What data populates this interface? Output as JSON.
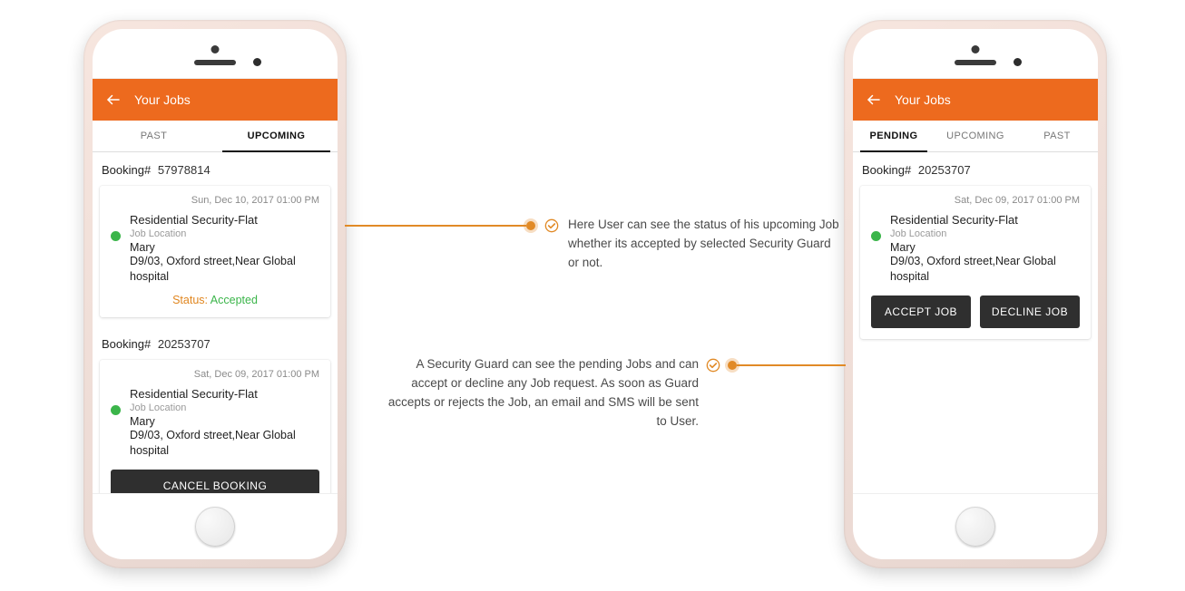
{
  "left": {
    "header": {
      "title": "Your Jobs"
    },
    "tabs": {
      "past": "PAST",
      "upcoming": "UPCOMING"
    },
    "bookingLabel": "Booking#",
    "booking1": {
      "number": "57978814",
      "date": "Sun, Dec 10, 2017 01:00 PM",
      "jobTitle": "Residential Security-Flat",
      "locationLabel": "Job Location",
      "name": "Mary",
      "address": "D9/03, Oxford street,Near Global hospital",
      "statusPrefix": "Status:",
      "statusValue": "Accepted"
    },
    "booking2": {
      "number": "20253707",
      "date": "Sat, Dec 09, 2017 01:00 PM",
      "jobTitle": "Residential Security-Flat",
      "locationLabel": "Job Location",
      "name": "Mary",
      "address": "D9/03, Oxford street,Near Global hospital",
      "cancelLabel": "CANCEL BOOKING"
    }
  },
  "right": {
    "header": {
      "title": "Your Jobs"
    },
    "tabs": {
      "pending": "PENDING",
      "upcoming": "UPCOMING",
      "past": "PAST"
    },
    "bookingLabel": "Booking#",
    "booking": {
      "number": "20253707",
      "date": "Sat, Dec 09, 2017 01:00 PM",
      "jobTitle": "Residential Security-Flat",
      "locationLabel": "Job Location",
      "name": "Mary",
      "address": "D9/03, Oxford street,Near Global hospital",
      "acceptLabel": "ACCEPT JOB",
      "declineLabel": "DECLINE JOB"
    }
  },
  "annotations": {
    "a1": "Here User can see the status of his upcoming Job whether its accepted by selected Security Guard or not.",
    "a2": "A Security Guard can see the pending Jobs and can accept or decline any Job request. As soon as Guard accepts or rejects the Job, an email and SMS will be sent to User."
  },
  "colors": {
    "accent": "#ed6a1e",
    "connector": "#e18a26",
    "success": "#3bb54a"
  }
}
